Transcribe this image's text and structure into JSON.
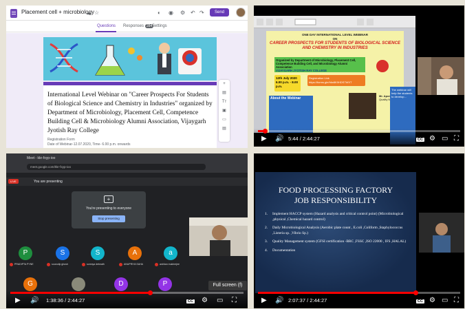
{
  "panel1": {
    "form_title": "Placement cell + microbiology",
    "send_label": "Send",
    "tabs": [
      {
        "label": "Questions"
      },
      {
        "label": "Responses",
        "badge": "284"
      },
      {
        "label": "Settings"
      }
    ],
    "heading": "International Level Webinar on \"Career Prospects For Students of Biological Science and Chemistry in Industries\" organized by Department of Microbiology, Placement Cell, Competence Building Cell & Microbiology Alumni Association, Vijaygarh Jyotish Ray College",
    "meta_line1": "Registration Form",
    "meta_line2": "Date of Webinar-12.07.2020, Time- 6.00 p.m. onwards",
    "side_tools": [
      "+",
      "▤",
      "Tт",
      "▣",
      "▭",
      "▤"
    ],
    "accent": "#673ab7"
  },
  "panel2": {
    "pdf_top": "ONE DAY INTERNATIONAL LEVEL WEBINAR",
    "pdf_on": "ON",
    "pdf_title": "CAREER PROSPECTS FOR STUDENTS OF BIOLOGICAL SCIENCE AND CHEMISTRY IN INDUSTRIES",
    "pdf_org": "Organized by Department of Microbiology, Placement Cell, Competence Building Cell, and Microbiology Alumni Association",
    "pdf_college": "VIJAYGARH JYOTISH RAY COLLEGE",
    "pdf_date": "12th July 2020",
    "pdf_time": "6.00 p.m. - 8.00 p.m.",
    "pdf_reg_label": "Registration Link",
    "pdf_reg_url": "https://forms.gle/hfw8K9HDS7WXT",
    "pdf_about": "About the Webinar",
    "pdf_speaker": "Mr. Apon Nayak",
    "pdf_speaker_role": "Quality Manager",
    "pdf_side_text": "The webinar will help the students to develop...",
    "time_current": "5:44",
    "time_total": "2:44:27",
    "progress": 0.035
  },
  "panel3": {
    "tab_title": "Meet - kkr-fxyp-ioo",
    "url": "meet.google.com/kkr-fxyp-ioo",
    "live_label": "LIVE",
    "presenting_label": "You are presenting",
    "center_message": "You're presenting to everyone",
    "stop_label": "Stop presenting",
    "participants": [
      {
        "initial": "P",
        "color": "#1e8e3e",
        "name": "PRADIPTA PYNE"
      },
      {
        "initial": "S",
        "color": "#1a73e8",
        "name": "sourodip ghosh"
      },
      {
        "initial": "S",
        "color": "#12b5cb",
        "name": "somnya debnath"
      },
      {
        "initial": "A",
        "color": "#e8710a",
        "name": "ANUPRIYA SAHA"
      },
      {
        "initial": "a",
        "color": "#12b5cb",
        "name": "anirban mukherjee"
      },
      {
        "initial": "G",
        "color": "#e8710a",
        "name": ""
      },
      {
        "initial": "",
        "color": "#8a8a7a",
        "name": ""
      },
      {
        "initial": "D",
        "color": "#9334e6",
        "name": ""
      },
      {
        "initial": "P",
        "color": "#9334e6",
        "name": ""
      }
    ],
    "fullscreen_label": "Full screen (f)",
    "time_current": "1:38:36",
    "time_total": "2:44:27",
    "progress": 0.6
  },
  "panel4": {
    "slide_title_1": "FOOD PROCESSING FACTORY",
    "slide_title_2": "JOB RESPONSIBILITY",
    "items": [
      {
        "n": "1.",
        "text": "Implement HACCP system (Hazard analysis and critical control point) (Microbiological ,physical ,Chemical hazard control)"
      },
      {
        "n": "2.",
        "text": "Daily Microbiological Analysis (Aerobic plate count , E.coli ,Coliform ,Staphylococcus ,Listeria sp. ,Vibrio Sp.)"
      },
      {
        "n": "3.",
        "text": "Quality Management system (GFSI certification -BRC ,FSSC ,ISO 22000 , IFS ,HALAL)"
      },
      {
        "n": "4.",
        "text": "Documentation"
      }
    ],
    "time_current": "2:07:37",
    "time_total": "2:44:27",
    "progress": 0.78
  }
}
